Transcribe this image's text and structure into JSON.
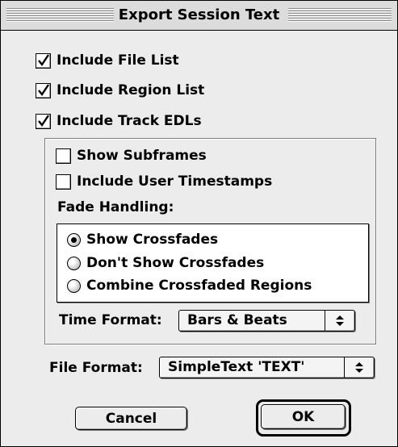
{
  "window": {
    "title": "Export Session Text"
  },
  "options": {
    "include_file_list": {
      "label": "Include File List",
      "checked": true
    },
    "include_region_list": {
      "label": "Include Region List",
      "checked": true
    },
    "include_track_edls": {
      "label": "Include Track EDLs",
      "checked": true
    }
  },
  "edl_options": {
    "show_subframes": {
      "label": "Show Subframes",
      "checked": false
    },
    "include_user_timestamps": {
      "label": "Include User Timestamps",
      "checked": false
    },
    "fade_handling_label": "Fade Handling:",
    "fade_options": [
      {
        "label": "Show Crossfades",
        "selected": true
      },
      {
        "label": "Don't Show Crossfades",
        "selected": false
      },
      {
        "label": "Combine Crossfaded Regions",
        "selected": false
      }
    ],
    "time_format_label": "Time Format:",
    "time_format_value": "Bars & Beats"
  },
  "file_format_label": "File Format:",
  "file_format_value": "SimpleText 'TEXT'",
  "buttons": {
    "cancel": "Cancel",
    "ok": "OK"
  },
  "icons": {
    "checkmark": "checkmark-icon",
    "popup_arrows": "up-down-arrows-icon"
  }
}
